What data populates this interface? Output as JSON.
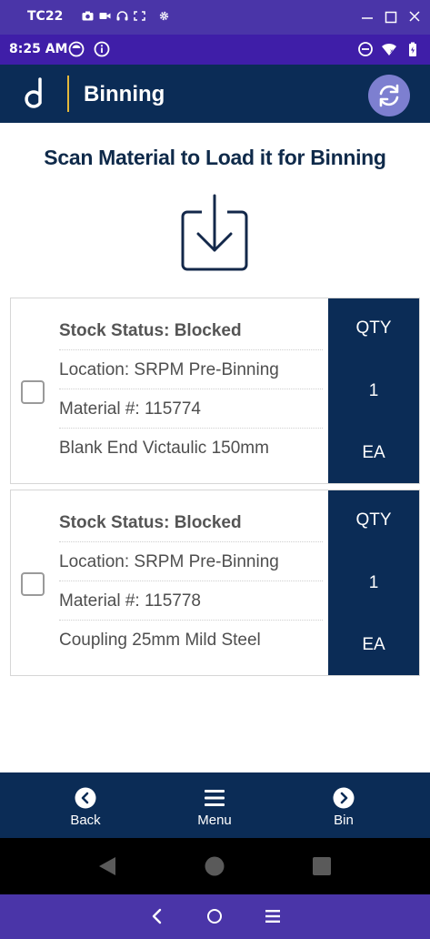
{
  "emulator": {
    "title": "TC22"
  },
  "status_bar": {
    "time": "8:25 AM"
  },
  "header": {
    "title": "Binning"
  },
  "main": {
    "heading": "Scan Material to Load it for Binning",
    "cards": [
      {
        "stock_status": "Stock Status: Blocked",
        "location": "Location: SRPM Pre-Binning",
        "material": "Material #: 115774",
        "description": "Blank End Victaulic 150mm",
        "qty_label": "QTY",
        "qty_value": "1",
        "qty_unit": "EA"
      },
      {
        "stock_status": "Stock Status: Blocked",
        "location": "Location: SRPM Pre-Binning",
        "material": "Material #: 115778",
        "description": "Coupling 25mm Mild Steel",
        "qty_label": "QTY",
        "qty_value": "1",
        "qty_unit": "EA"
      }
    ]
  },
  "bottom_nav": {
    "back_label": "Back",
    "menu_label": "Menu",
    "bin_label": "Bin"
  },
  "colors": {
    "primary_navy": "#0b2c56",
    "emulator_purple": "#4a35a8",
    "status_purple": "#3f1ea8",
    "refresh_button": "#7d7fd0",
    "logo_accent": "#e5b93a"
  },
  "icons": {
    "refresh": "refresh-icon",
    "scan": "download-tray-icon",
    "back": "chevron-left-circle-icon",
    "menu": "hamburger-menu-icon",
    "bin": "chevron-right-circle-icon"
  }
}
